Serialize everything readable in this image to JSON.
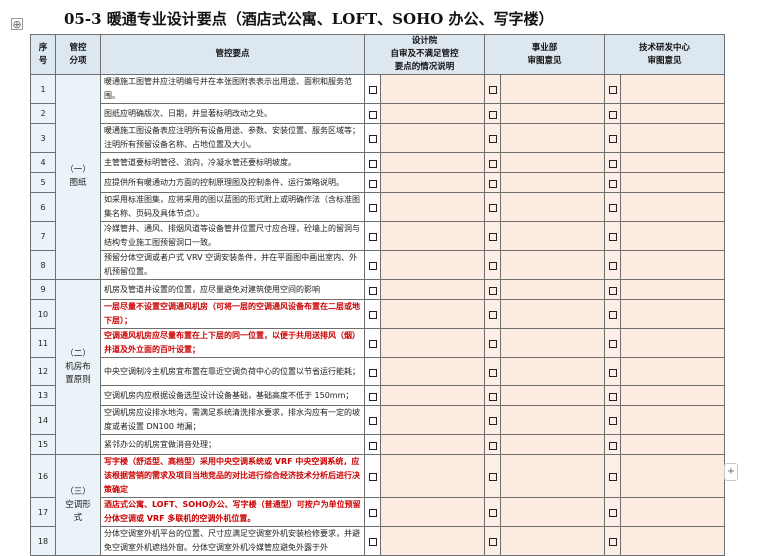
{
  "title": "05-3 暖通专业设计要点（酒店式公寓、LOFT、SOHO 办公、写字楼）",
  "header": {
    "seq": [
      "序",
      "号"
    ],
    "cat": [
      "管控",
      "分项"
    ],
    "req": "管控要点",
    "design": [
      "设计院",
      "自审及不满足管控",
      "要点的情况说明"
    ],
    "dept": [
      "事业部",
      "审图意见"
    ],
    "tech": [
      "技术研发中心",
      "审图意见"
    ]
  },
  "categories": [
    {
      "lines": [
        "（一）",
        "图纸"
      ]
    },
    {
      "lines": [
        "（二）",
        "机房布",
        "置原则"
      ]
    },
    {
      "lines": [
        "（三）",
        "空调形",
        "式"
      ]
    }
  ],
  "rows": [
    {
      "seq": "1",
      "text": "暖通施工图管井应注明编号并在本张图附表表示出用途、面积和服务范围。",
      "red": false
    },
    {
      "seq": "2",
      "text": "图纸应明确版次、日期，并显著标明改动之处。",
      "red": false
    },
    {
      "seq": "3",
      "text": "暖通施工图设备表应注明所有设备用途、参数、安装位置、服务区域等；注明所有预留设备名称、占地位置及大小。",
      "red": false
    },
    {
      "seq": "4",
      "text": "主管管道要标明管径、流向，冷凝水管还要标明坡度。",
      "red": false
    },
    {
      "seq": "5",
      "text": "应提供所有暖通动力方面的控制原理图及控制条件、运行策略说明。",
      "red": false
    },
    {
      "seq": "6",
      "text": "如采用标准图集，应将采用的图以蓝图的形式附上或明确作法（含标准图集名称、页码及具体节点）。",
      "red": false
    },
    {
      "seq": "7",
      "text": "冷媒管井、通风、排烟风道等设备管井位置尺寸应合理，砼墙上的留洞与结构专业施工图预留洞口一致。",
      "red": false
    },
    {
      "seq": "8",
      "text": "预留分体空调或者户式 VRV 空调安装条件，并在平面图中画出室内、外机预留位置。",
      "red": false
    },
    {
      "seq": "9",
      "text": "机房及管道井设置的位置，应尽量避免对建筑使用空间的影响",
      "red": false
    },
    {
      "seq": "10",
      "text": "一层尽量不设置空调通风机房（可将一层的空调通风设备布置在二层或地下层）；",
      "red": true
    },
    {
      "seq": "11",
      "text": "空调通风机房应尽量布置在上下层的同一位置，以便于共用送排风（烟）井道及外立面的百叶设置；",
      "red": true
    },
    {
      "seq": "12",
      "text": "中央空调制冷主机房宜布置在靠近空调负荷中心的位置以节省运行能耗；",
      "red": false
    },
    {
      "seq": "13",
      "text": "空调机房内应根据设备选型设计设备基础，基础高度不低于 150mm；",
      "red": false
    },
    {
      "seq": "14",
      "text": "空调机房应设排水地沟，需满足系统清洗排水要求，排水沟应有一定的坡度或者设置 DN100 地漏；",
      "red": false
    },
    {
      "seq": "15",
      "text": "紧邻办公的机房宜做消音处理；",
      "red": false
    },
    {
      "seq": "16",
      "text": "写字楼（舒适型、高档型）采用中央空调系统或 VRF 中央空调系统，应该根据营销的需求及项目当地竞品的对比进行综合经济技术分析后进行决策确定",
      "red": true
    },
    {
      "seq": "17",
      "text": "酒店式公寓、LOFT、SOHO办公、写字楼（普通型）可按户为单位预留分体空调或 VRF 多联机的空调外机位置。",
      "red": true
    },
    {
      "seq": "18",
      "text": "分体空调室外机平台的位置、尺寸应满足空调室外机安装检修要求，并避免空调室外机遮挡外窗。分体空调室外机冷媒管应避免外露于外",
      "red": false
    }
  ]
}
